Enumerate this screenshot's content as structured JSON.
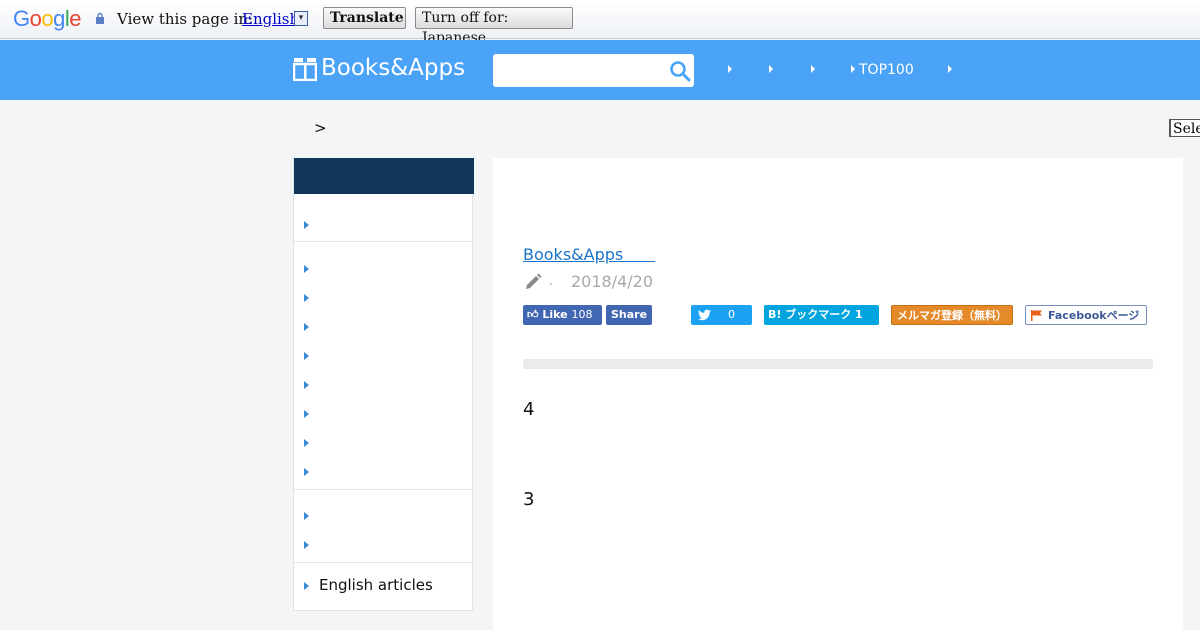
{
  "translate_bar": {
    "logo": "Google",
    "prompt": "View this page in:",
    "language": "English",
    "dropdown_glyph": "▾",
    "translate_button": "Translate",
    "turn_off_button": "Turn off for: Japanese"
  },
  "header": {
    "logo_text": "Books&Apps",
    "search_placeholder": "",
    "nav": [
      "",
      "",
      "",
      "TOP100",
      ""
    ]
  },
  "breadcrumb": ">",
  "select_label": "Select Language",
  "sidebar": {
    "group1": [
      ""
    ],
    "group2": [
      "",
      "",
      "",
      "",
      "",
      "",
      "",
      ""
    ],
    "group3": [
      "",
      ""
    ],
    "group4": [
      "English articles"
    ]
  },
  "article": {
    "author_link": "Books&Apps　　",
    "byline_dot": ".",
    "date": "2018/4/20",
    "share": {
      "fb_like_label": "Like",
      "fb_like_count": "108",
      "fb_share_label": "Share",
      "twitter_count": "0",
      "hatena_label": "B! ブックマーク 1",
      "mail_label": "メルマガ登録（無料）",
      "facebook_page_label": "Facebookページ"
    },
    "body_numbers": [
      "4",
      "3"
    ]
  },
  "colors": {
    "header_blue": "#4aa3f7",
    "sidebar_header_navy": "#12355a",
    "link_blue": "#1a73c8"
  }
}
